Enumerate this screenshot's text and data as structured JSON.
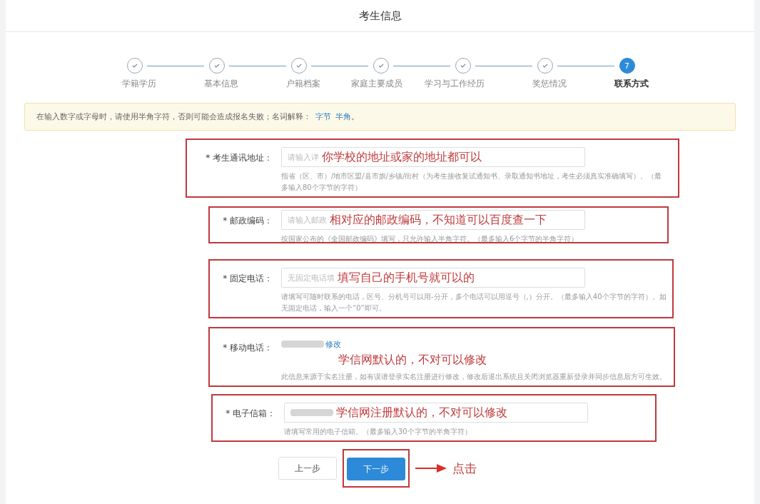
{
  "title": "考生信息",
  "steps": [
    {
      "label": "学籍学历",
      "selected": false
    },
    {
      "label": "基本信息",
      "selected": false
    },
    {
      "label": "户籍档案",
      "selected": false
    },
    {
      "label": "家庭主要成员",
      "selected": false
    },
    {
      "label": "学习与工作经历",
      "selected": false
    },
    {
      "label": "奖惩情况",
      "selected": false
    },
    {
      "label": "联系方式",
      "number": "7",
      "selected": true
    }
  ],
  "notice": {
    "text": "在输入数字或字母时，请使用半角字符，否则可能会造成报名失败；名词解释：",
    "links": [
      "字节",
      "半角。"
    ]
  },
  "fields": [
    {
      "kind": "input",
      "label": "* 考生通讯地址：",
      "placeholder": "请输入详",
      "annotation": "你学校的地址或家的地址都可以",
      "hint": "指省（区、市）/地市区盟/县市旗/乡镇/街村（为考生接收复试通知书、录取通知书地址，考生必须真实准确填写）。（最多输入80个字节的字符）"
    },
    {
      "kind": "input",
      "label": "* 邮政编码：",
      "placeholder": "请输入邮政",
      "annotation": "相对应的邮政编码，不知道可以百度查一下",
      "hint": "按国家公布的《全国邮政编码》填写，只允许输入半角字符。（最多输入6个字节的半角字符）"
    },
    {
      "kind": "input",
      "label": "* 固定电话：",
      "placeholder": "无固定电话填",
      "annotation": "填写自己的手机号就可以的",
      "hint": "请填写可随时联系的电话，区号、分机号可以用-分开，多个电话可以用逗号（,）分开。（最多输入40个字节的字符）。如无固定电话，输入一个“0”即可。"
    },
    {
      "kind": "readonly",
      "label": "* 移动电话：",
      "link": "修改",
      "annotation": "学信网默认的，不对可以修改",
      "hint": "此信息来源于实名注册，如有误请登录实名注册进行修改，修改后退出系统且关闭浏览器重新登录并同步信息后方可生效。"
    },
    {
      "kind": "input",
      "label": "* 电子信箱：",
      "annotation": "学信网注册默认的，不对可以修改",
      "hint": "请填写常用的电子信箱。（最多输入30个字节的半角字符）"
    }
  ],
  "buttons": [
    {
      "label": "上一步",
      "kind": "secondary"
    },
    {
      "label": "下一步",
      "kind": "primary"
    }
  ],
  "callout": "点击"
}
